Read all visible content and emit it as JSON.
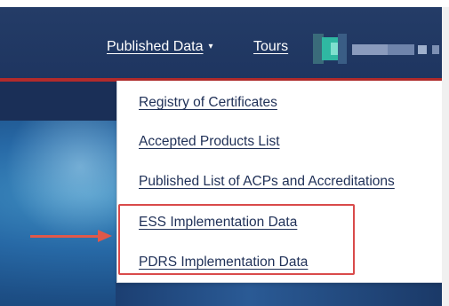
{
  "navbar": {
    "published_data_label": "Published Data",
    "caret_glyph": "▾",
    "tours_label": "Tours",
    "obscured_user_icon": "pixelated-avatar-icon",
    "background_color": "#243c67",
    "accent_rule_color": "#b22b2b"
  },
  "dropdown": {
    "items": [
      {
        "label": "Registry of Certificates"
      },
      {
        "label": "Accepted Products List"
      },
      {
        "label": "Published List of ACPs and Accreditations"
      },
      {
        "label": "ESS Implementation Data"
      },
      {
        "label": "PDRS Implementation Data"
      }
    ],
    "link_color": "#1f3057"
  },
  "annotation": {
    "highlight_color": "#d94a4a",
    "arrow_color": "#e0584a",
    "arrow_icon": "right-arrow-icon"
  }
}
